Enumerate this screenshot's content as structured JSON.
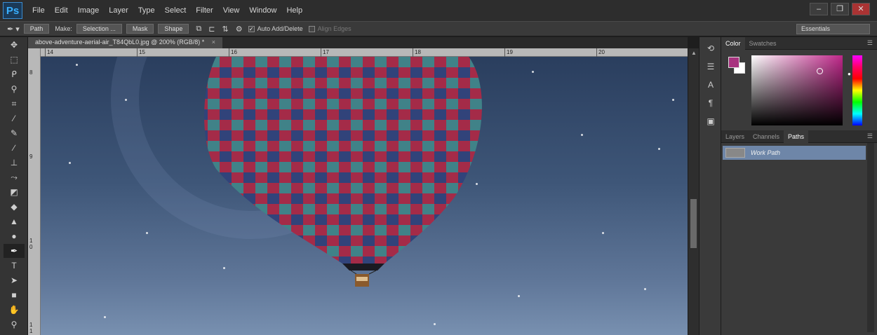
{
  "app": {
    "logo": "Ps",
    "menu": [
      "File",
      "Edit",
      "Image",
      "Layer",
      "Type",
      "Select",
      "Filter",
      "View",
      "Window",
      "Help"
    ],
    "window_controls": {
      "minimize": "–",
      "restore": "❐",
      "close": "✕"
    }
  },
  "options_bar": {
    "tool_icon": "pen-icon",
    "mode": "Path",
    "make_label": "Make:",
    "selection_button": "Selection ...",
    "mask_button": "Mask",
    "shape_button": "Shape",
    "auto_add_delete": {
      "label": "Auto Add/Delete",
      "checked": true
    },
    "align_edges": {
      "label": "Align Edges",
      "checked": false
    },
    "workspace": "Essentials"
  },
  "tools": [
    {
      "icon": "move-icon",
      "glyph": "✥"
    },
    {
      "icon": "marquee-icon",
      "glyph": "⬚"
    },
    {
      "icon": "lasso-icon",
      "glyph": "ᑭ"
    },
    {
      "icon": "magic-wand-icon",
      "glyph": "⚲"
    },
    {
      "icon": "crop-icon",
      "glyph": "⌗"
    },
    {
      "icon": "eyedropper-icon",
      "glyph": "⁄"
    },
    {
      "icon": "healing-brush-icon",
      "glyph": "✎"
    },
    {
      "icon": "brush-icon",
      "glyph": "∕"
    },
    {
      "icon": "clone-stamp-icon",
      "glyph": "⊥"
    },
    {
      "icon": "history-brush-icon",
      "glyph": "⤳"
    },
    {
      "icon": "eraser-icon",
      "glyph": "◩"
    },
    {
      "icon": "paint-bucket-icon",
      "glyph": "◆"
    },
    {
      "icon": "blur-icon",
      "glyph": "▲"
    },
    {
      "icon": "dodge-icon",
      "glyph": "●"
    },
    {
      "icon": "pen-icon",
      "glyph": "✒",
      "active": true
    },
    {
      "icon": "type-icon",
      "glyph": "T"
    },
    {
      "icon": "path-selection-icon",
      "glyph": "➤"
    },
    {
      "icon": "rectangle-icon",
      "glyph": "■"
    },
    {
      "icon": "hand-icon",
      "glyph": "✋"
    },
    {
      "icon": "zoom-icon",
      "glyph": "⚲"
    }
  ],
  "document": {
    "tab_title": "above-adventure-aerial-air_T84QbL0.jpg @ 200% (RGB/8) *",
    "close_glyph": "×",
    "ruler_top": [
      "14",
      "15",
      "16",
      "17",
      "18",
      "19",
      "20"
    ],
    "ruler_left": [
      "8",
      "9",
      "1\n0",
      "1\n1"
    ]
  },
  "dock": [
    {
      "icon": "history-icon",
      "glyph": "⟲"
    },
    {
      "icon": "properties-icon",
      "glyph": "☰"
    },
    {
      "icon": "character-icon",
      "glyph": "A"
    },
    {
      "icon": "paragraph-icon",
      "glyph": "¶"
    },
    {
      "icon": "tool-presets-icon",
      "glyph": "▣"
    }
  ],
  "color_panel": {
    "tabs": [
      "Color",
      "Swatches"
    ],
    "active_tab": "Color",
    "foreground": "#a8337f",
    "background": "#ffffff"
  },
  "layers_panel": {
    "tabs": [
      "Layers",
      "Channels",
      "Paths"
    ],
    "active_tab": "Paths",
    "paths": [
      "Work Path"
    ]
  }
}
